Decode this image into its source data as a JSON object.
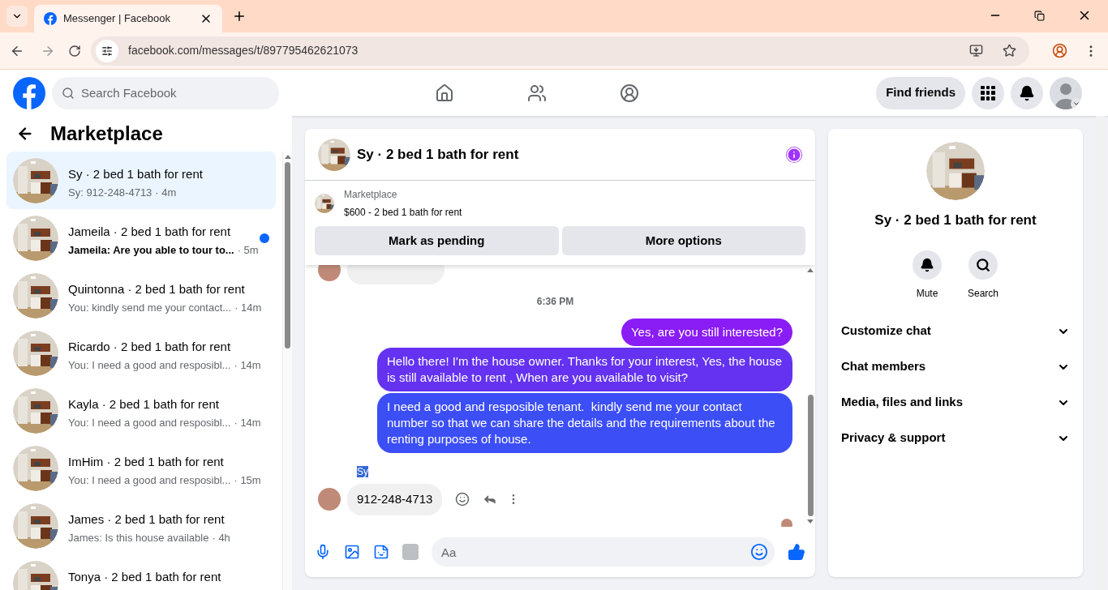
{
  "browser": {
    "tab_title": "Messenger | Facebook",
    "url": "facebook.com/messages/t/897795462621073"
  },
  "header": {
    "search_placeholder": "Search Facebook",
    "find_friends": "Find friends"
  },
  "sidebar": {
    "title": "Marketplace",
    "conversations": [
      {
        "title": "Sy · 2 bed 1 bath for rent",
        "preview": "Sy: 912-248-4713",
        "time": "· 4m",
        "selected": true,
        "unread": false
      },
      {
        "title": "Jameila · 2 bed 1 bath for rent",
        "preview": "Jameila: Are you able to tour to...",
        "time": "· 5m",
        "selected": false,
        "unread": true
      },
      {
        "title": "Quintonna · 2 bed 1 bath for rent",
        "preview": "You: kindly send me your contact...",
        "time": "· 14m",
        "selected": false,
        "unread": false
      },
      {
        "title": "Ricardo · 2 bed 1 bath for rent",
        "preview": "You: I need a good and resposibl...",
        "time": "· 14m",
        "selected": false,
        "unread": false
      },
      {
        "title": "Kayla · 2 bed 1 bath for rent",
        "preview": "You: I need a good and resposibl...",
        "time": "· 14m",
        "selected": false,
        "unread": false
      },
      {
        "title": "ImHim · 2 bed 1 bath for rent",
        "preview": "You: I need a good and resposibl...",
        "time": "· 15m",
        "selected": false,
        "unread": false
      },
      {
        "title": "James · 2 bed 1 bath for rent",
        "preview": "James: Is this house available",
        "time": "· 4h",
        "selected": false,
        "unread": false
      },
      {
        "title": "Tonya · 2 bed 1 bath for rent",
        "selected": false,
        "unread": false
      }
    ]
  },
  "chat": {
    "title": "Sy · 2 bed 1 bath for rent",
    "listing": {
      "label": "Marketplace",
      "text": "$600 - 2 bed 1 bath for rent"
    },
    "actions": [
      "Mark as pending",
      "More options"
    ],
    "messages": [
      {
        "kind": "incoming-cut"
      },
      {
        "kind": "time",
        "text": "6:36 PM"
      },
      {
        "kind": "outgoing",
        "text": "Yes, are you still interested?"
      },
      {
        "kind": "outgoing",
        "text": "Hello there! I'm the house owner. Thanks for your interest, Yes, the house is still available to rent , When are you available to visit?"
      },
      {
        "kind": "outgoing",
        "text": "I need a good and resposible tenant.  kindly send me your contact number so that we can share the details and the requirements about the renting purposes of house."
      },
      {
        "kind": "sender",
        "text": "Sy"
      },
      {
        "kind": "incoming",
        "text": "912-248-4713"
      }
    ],
    "composer_placeholder": "Aa"
  },
  "details": {
    "title": "Sy · 2 bed 1 bath for rent",
    "actions": [
      {
        "kind": "mute",
        "label": "Mute"
      },
      {
        "kind": "search",
        "label": "Search"
      }
    ],
    "sections": [
      "Customize chat",
      "Chat members",
      "Media, files and links",
      "Privacy & support"
    ]
  }
}
